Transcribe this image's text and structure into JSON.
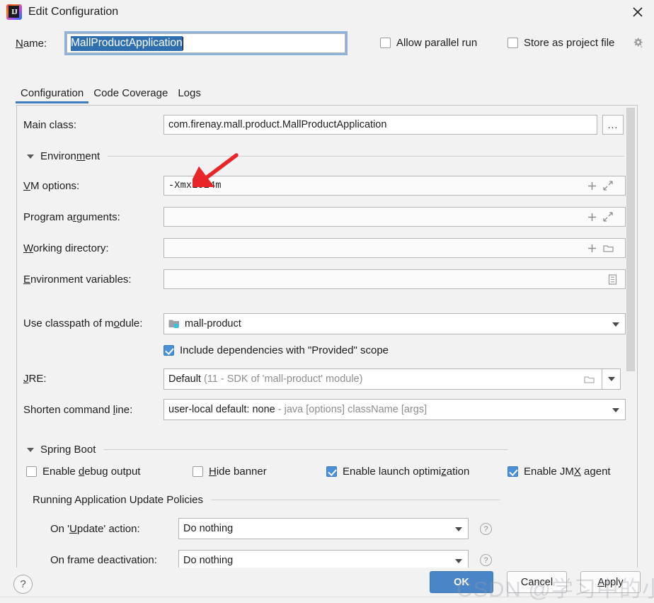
{
  "window": {
    "title": "Edit Configuration",
    "app_icon": "intellij-idea-logo",
    "close_icon": "close-icon"
  },
  "name_row": {
    "label": "Name:",
    "label_mnemonic": "N",
    "value": "MallProductApplication",
    "allow_parallel_run": {
      "label": "Allow parallel run",
      "checked": false
    },
    "store_as_project_file": {
      "label": "Store as project file",
      "checked": false
    },
    "gear_icon": "gear-icon"
  },
  "tabs": [
    {
      "label": "Configuration",
      "active": true
    },
    {
      "label": "Code Coverage",
      "active": false
    },
    {
      "label": "Logs",
      "active": false
    }
  ],
  "form": {
    "main_class": {
      "label": "Main class:",
      "value": "com.firenay.mall.product.MallProductApplication",
      "browse_button": "..."
    },
    "environment_section": {
      "title": "Environment",
      "expanded": true
    },
    "vm_options": {
      "label": "VM options:",
      "label_mnemonic": "V",
      "value": "-Xmx1024m",
      "icons": [
        "plus-icon",
        "expand-icon"
      ]
    },
    "program_arguments": {
      "label": "Program arguments:",
      "value": "",
      "icons": [
        "plus-icon",
        "expand-icon"
      ]
    },
    "working_directory": {
      "label": "Working directory:",
      "value": "",
      "icons": [
        "plus-icon",
        "folder-icon"
      ]
    },
    "environment_variables": {
      "label": "Environment variables:",
      "value": "",
      "icons": [
        "list-icon"
      ]
    },
    "use_classpath_of_module": {
      "label": "Use classpath of module:",
      "value": "mall-product",
      "module_icon": "module-folder-icon"
    },
    "include_provided_scope": {
      "label": "Include dependencies with \"Provided\" scope",
      "checked": true
    },
    "jre": {
      "label": "JRE:",
      "value": "Default",
      "hint": "(11 - SDK of 'mall-product' module)",
      "folder_icon": "folder-icon"
    },
    "shorten_command_line": {
      "label": "Shorten command line:",
      "value": "user-local default: none",
      "hint": "- java [options] className [args]"
    },
    "spring_boot_section": {
      "title": "Spring Boot",
      "expanded": true
    },
    "spring_boot_checkboxes": [
      {
        "label": "Enable debug output",
        "checked": false
      },
      {
        "label": "Hide banner",
        "checked": false
      },
      {
        "label": "Enable launch optimization",
        "checked": true
      },
      {
        "label": "Enable JMX agent",
        "checked": true
      }
    ],
    "update_policies_section": {
      "title": "Running Application Update Policies"
    },
    "on_update_action": {
      "label": "On 'Update' action:",
      "value": "Do nothing",
      "help_icon": "help-icon"
    },
    "on_frame_deactivation": {
      "label": "On frame deactivation:",
      "value": "Do nothing",
      "help_icon": "help-icon"
    }
  },
  "footer": {
    "help_label": "?",
    "ok_label": "OK",
    "cancel_label": "Cancel",
    "apply_label": "Apply"
  },
  "watermark": {
    "text": "CSDN @学习中的小鸟没"
  },
  "annotation": {
    "arrow_icon": "red-arrow-annotation",
    "color": "#e8262a"
  }
}
